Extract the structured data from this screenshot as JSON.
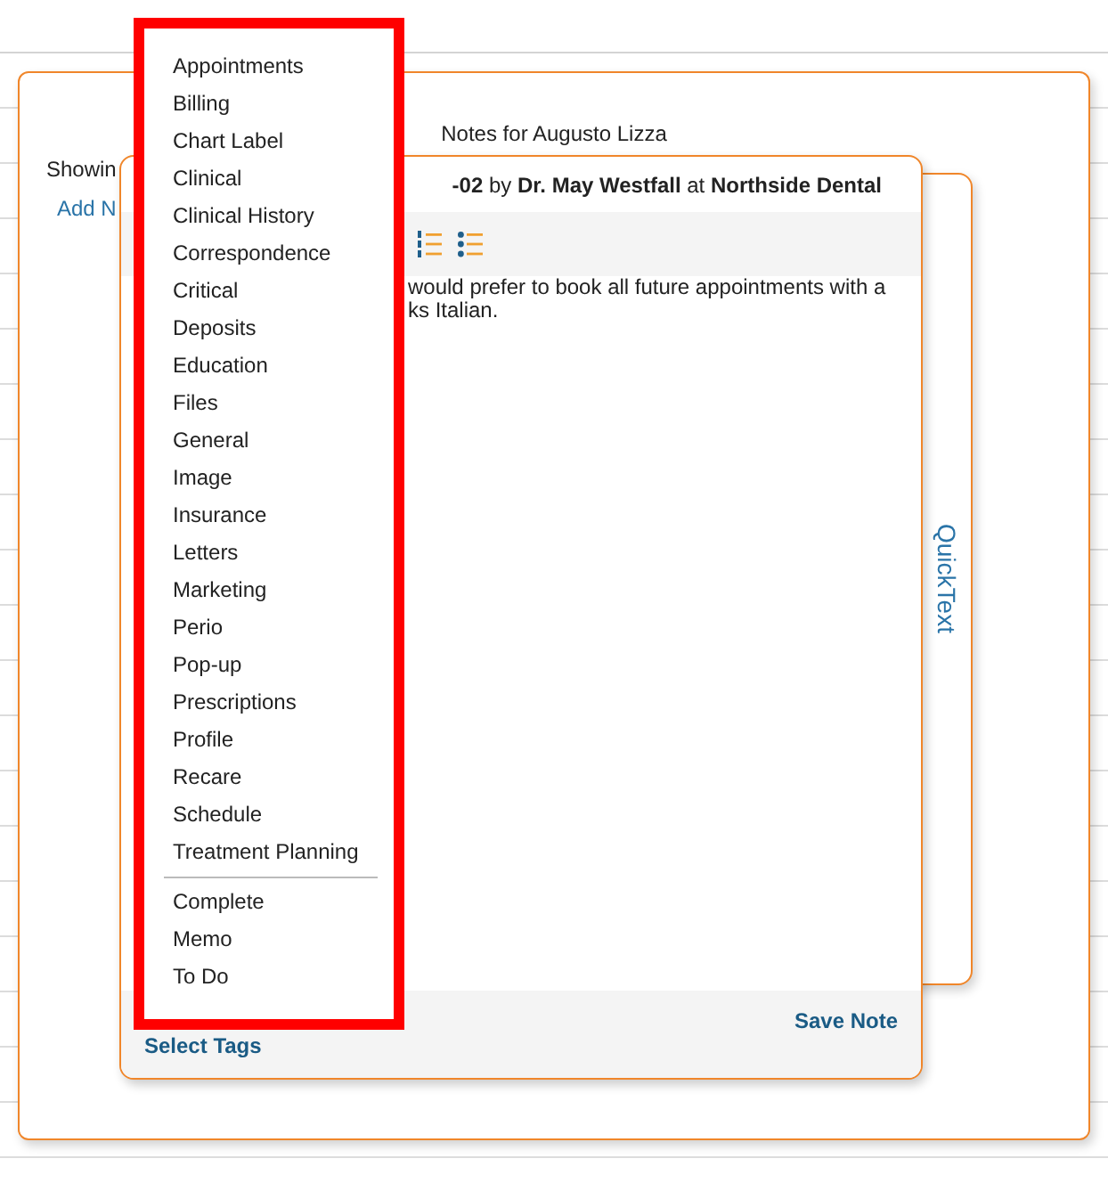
{
  "window": {
    "title": "Notes for Augusto Lizza"
  },
  "background": {
    "showing_text": "Showin",
    "add_note_link": "Add N"
  },
  "quicktext_tab": {
    "label": "QuickText"
  },
  "note_editor": {
    "header": "**-02** by **Dr. May Westfall** at **Northside Dental**",
    "body_lines": [
      "would prefer to book all future appointments with a",
      "ks Italian."
    ],
    "save_button": "Save Note",
    "select_tags_link": "Select Tags"
  },
  "tags_menu": {
    "groups": [
      {
        "items": [
          "Appointments",
          "Billing",
          "Chart Label",
          "Clinical",
          "Clinical History",
          "Correspondence",
          "Critical",
          "Deposits",
          "Education",
          "Files",
          "General",
          "Image",
          "Insurance",
          "Letters",
          "Marketing",
          "Perio",
          "Pop-up",
          "Prescriptions",
          "Profile",
          "Recare",
          "Schedule",
          "Treatment Planning"
        ]
      },
      {
        "items": [
          "Complete",
          "Memo",
          "To Do"
        ]
      }
    ]
  }
}
